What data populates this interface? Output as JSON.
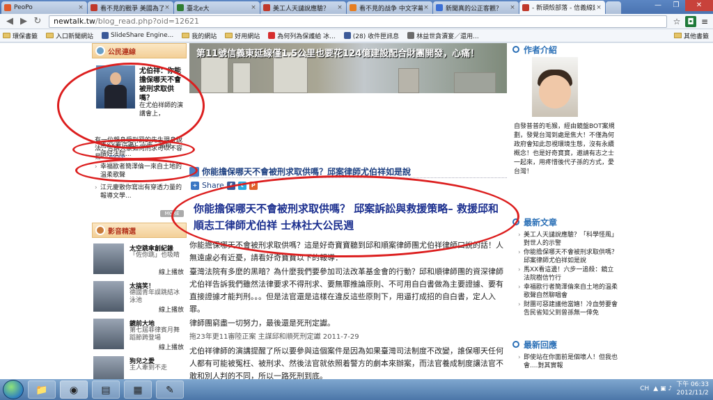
{
  "tabs": [
    {
      "label": "PeoPo",
      "active": false,
      "icon_color": "#e05a2b"
    },
    {
      "label": "看不見的戰爭 美國為了",
      "active": false,
      "icon_color": "#c0392b"
    },
    {
      "label": "臺北e大",
      "active": false,
      "icon_color": "#2e7d32"
    },
    {
      "label": "美工人天譴說應驗？",
      "active": false,
      "icon_color": "#c0392b"
    },
    {
      "label": "看不見的战争 中文字幕",
      "active": false,
      "icon_color": "#e67e22"
    },
    {
      "label": "新聞真的公正客觀？",
      "active": false,
      "icon_color": "#3b6fd6"
    },
    {
      "label": "- 新頭殼部落 - 信義線延",
      "active": true,
      "icon_color": "#c0392b"
    }
  ],
  "address": {
    "host": "newtalk.tw",
    "path": "/blog_read.php?oid=12621"
  },
  "bookmarks": [
    {
      "label": "環保書籤",
      "type": "folder"
    },
    {
      "label": "入口新聞網站",
      "type": "folder"
    },
    {
      "label": "SlideShare Engine...",
      "type": "site"
    },
    {
      "label": "我的網站",
      "type": "folder"
    },
    {
      "label": "好用網站",
      "type": "folder"
    },
    {
      "label": "為何列為保護給 冰...",
      "type": "site"
    },
    {
      "label": "(28) 收件匣訊息",
      "type": "site"
    },
    {
      "label": "林益世貪瀆宴／還用...",
      "type": "site"
    }
  ],
  "bookmarks_other": "其他書籤",
  "left": {
    "box_title": "公民連線",
    "feature_title": "尤伯祥：你能擔保哪天不會被刑求取供嗎？",
    "feature_sub": "在尤伯祥師的演講會上，",
    "feature_desc": "有一位親身受刑罰的先生現身說法，告訴大家如何刑求可以不容易...",
    "feature_more": "more",
    "list": [
      "馬XX看這邊！六步一追殺，讀好法院...",
      "幸福歐者簡澤倫一來自土地的溫柔歌聲",
      "江元慶散你寫出有穿透力量的報導文學..."
    ],
    "more_button": "MORE",
    "video_box_title": "影音精選",
    "videos": [
      {
        "title": "太空跳傘創紀錄",
        "desc": "「佐你跳」也吸睛",
        "play": "線上播放"
      },
      {
        "title": "太搞笑！",
        "desc": "德國青年誤跳結冰泳池",
        "play": "線上播放"
      },
      {
        "title": "鏡前大地",
        "desc": "第七屆菲律賓月舞蹈節跨登場",
        "play": "線上播放"
      },
      {
        "title": "狗兒之愛",
        "desc": "主人牽到不走",
        "play": "線上播放"
      }
    ]
  },
  "center": {
    "banner_text": "第11號信義東延線僅1.5公里也要花124億建設配合財團開發，心痛！",
    "post_title": "你能擔保哪天不會被刑求取供嗎？邱案律師尤伯祥如是說",
    "share_label": "Share",
    "big_title": "你能擔保哪天不會被刑求取供嗎？ 邱案訴訟與救援策略– 救援邱和順志工律師尤伯祥 士林社大公民週",
    "paragraphs": [
      "你能擔保哪天不會被刑求取供嗎？這是好奇寶寶聽到邱和順案律師團尤伯祥律師口說的話！人無遠慮必有近憂，請看好奇寶寶以下的報導：",
      "臺灣法院有多麼的黑暗？為什麼我們要參加司法改革基金會的行動？邱和順律師團的資深律師尤伯祥告訴我們雖然法律要求不得刑求、要無罪推論原則、不可用自白書做為主要證據、要有直接證據才能判刑。。。但是法官還是這樣在違反這些原則下，用逼打成招的自白書，定人入罪。",
      "律師團窮盡一切努力，最後還是死刑定讞。"
    ],
    "meta": "拖23年更11審陸正案 主謀邱和順死刑定讞 2011-7-29",
    "tail": "尤伯祥律師的演講提醒了所以要參與這個案件是因為如果臺灣司法制度不改變，誰保哪天任何人都有可能被冤枉、被刑求、然後法官就依照着警方的劇本來辦案，而法官養成制度讓法官不敢和別人判的不同，所以一路死刑到底。"
  },
  "right": {
    "author_heading": "作者介紹",
    "author_text": "自發普普的毛猴，經由鏡盤BOT案規劃，發覺台灣到處是焦大！不僅為何政府會知此忽視環境生態，沒有永續概念！也是好奇寶寶，邀請有志之士一起來，用疼惜後代子孫的方式，愛台灣！",
    "latest_heading": "最新文章",
    "latest": [
      "美工人天譴說應驗？「科學怪風」對世人的示警",
      "你能擔保哪天不會被刑求取供嗎？邱案律師尤伯祥如是說",
      "馬XX看這邊！六步一追殺：鏡立法院樹信竹行",
      "幸福歐行者簡澤倫來自土地的溫柔歌聲自然聊唱會",
      "財團可惡建議他當嬉！冷血勞要會告民省知父到曾孫無一倖免"
    ],
    "reply_heading": "最新回應",
    "replies": [
      "即使站在你面前是個壞人！但我也會....對其實報"
    ]
  },
  "taskbar": {
    "lang": "CH",
    "time": "下午 06:33",
    "date": "2012/11/2"
  }
}
